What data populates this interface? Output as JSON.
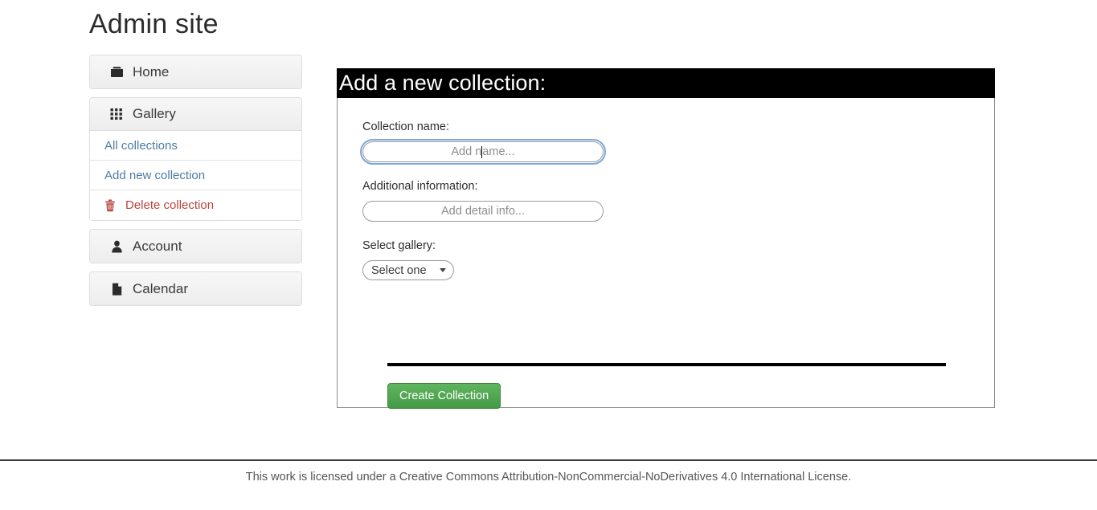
{
  "site": {
    "title": "Admin site"
  },
  "sidebar": {
    "panels": [
      {
        "heading_label": "Home",
        "heading_icon": "folder-icon",
        "items": []
      },
      {
        "heading_label": "Gallery",
        "heading_icon": "grid-icon",
        "items": [
          {
            "label": "All collections",
            "icon": null,
            "style": "link"
          },
          {
            "label": "Add new collection",
            "icon": null,
            "style": "link"
          },
          {
            "label": "Delete collection",
            "icon": "trash-icon",
            "style": "danger"
          }
        ]
      },
      {
        "heading_label": "Account",
        "heading_icon": "user-icon",
        "items": []
      },
      {
        "heading_label": "Calendar",
        "heading_icon": "page-icon",
        "items": []
      }
    ]
  },
  "main": {
    "header_title": "Add a new collection:",
    "fields": {
      "collection_name": {
        "label": "Collection name:",
        "placeholder": "Add name...",
        "value": "",
        "focused": true
      },
      "additional_information": {
        "label": "Additional information:",
        "placeholder": "Add detail info...",
        "value": "",
        "focused": false
      },
      "select_gallery": {
        "label": "Select gallery:",
        "selected": "Select one",
        "options": [
          "Select one"
        ]
      }
    },
    "submit_label": "Create Collection"
  },
  "footer": {
    "license_text": "This work is licensed under a Creative Commons Attribution-NonCommercial-NoDerivatives 4.0 International License."
  },
  "colors": {
    "accent_link": "#4c7ba5",
    "danger": "#b7443a",
    "submit_green": "#459a45",
    "header_bar": "#000000",
    "focus_ring": "#7aa7dd"
  }
}
